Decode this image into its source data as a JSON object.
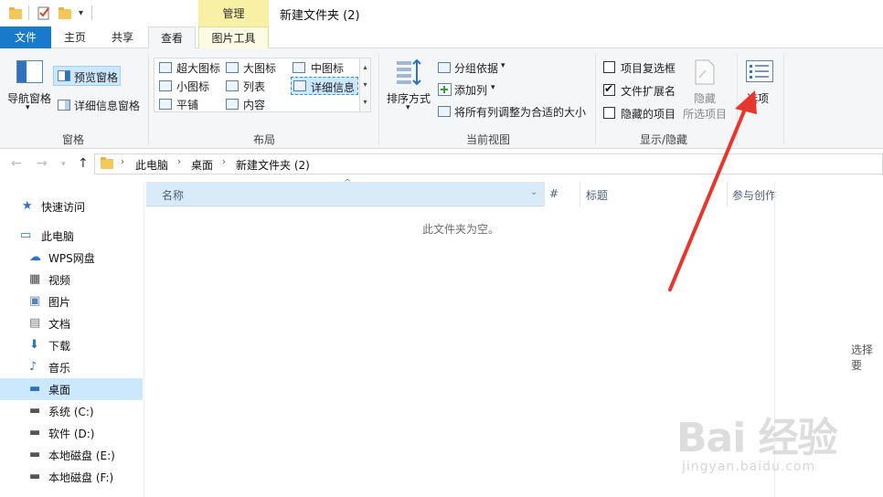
{
  "window": {
    "title": "新建文件夹 (2)",
    "context_tab": "管理"
  },
  "tabs": {
    "file": "文件",
    "home": "主页",
    "share": "共享",
    "view": "查看",
    "picture_tools": "图片工具"
  },
  "ribbon": {
    "panes": {
      "nav_pane": "导航窗格",
      "preview_pane": "预览窗格",
      "details_pane": "详细信息窗格",
      "label": "窗格"
    },
    "layout": {
      "extra_large": "超大图标",
      "large": "大图标",
      "medium": "中图标",
      "small": "小图标",
      "list": "列表",
      "details": "详细信息",
      "tiles": "平铺",
      "content": "内容",
      "label": "布局"
    },
    "current_view": {
      "sort_by": "排序方式",
      "group_by": "分组依据",
      "add_columns": "添加列",
      "size_columns": "将所有列调整为合适的大小",
      "label": "当前视图"
    },
    "show_hide": {
      "item_checkboxes": "项目复选框",
      "file_extensions": "文件扩展名",
      "hidden_items": "隐藏的项目",
      "hide_selected_1": "隐藏",
      "hide_selected_2": "所选项目",
      "options": "选项",
      "label": "显示/隐藏",
      "item_checkboxes_checked": false,
      "file_extensions_checked": true,
      "hidden_items_checked": false
    }
  },
  "address": {
    "crumbs": [
      "此电脑",
      "桌面",
      "新建文件夹 (2)"
    ]
  },
  "nav": {
    "items": [
      {
        "label": "快速访问",
        "icon": "star-icon"
      },
      {
        "label": "此电脑",
        "icon": "computer-icon"
      },
      {
        "label": "WPS网盘",
        "icon": "cloud-icon"
      },
      {
        "label": "视频",
        "icon": "video-icon"
      },
      {
        "label": "图片",
        "icon": "picture-icon"
      },
      {
        "label": "文档",
        "icon": "document-icon"
      },
      {
        "label": "下载",
        "icon": "download-icon"
      },
      {
        "label": "音乐",
        "icon": "music-icon"
      },
      {
        "label": "桌面",
        "icon": "desktop-icon"
      },
      {
        "label": "系统 (C:)",
        "icon": "drive-icon"
      },
      {
        "label": "软件 (D:)",
        "icon": "drive-icon"
      },
      {
        "label": "本地磁盘 (E:)",
        "icon": "drive-icon"
      },
      {
        "label": "本地磁盘 (F:)",
        "icon": "drive-icon"
      }
    ],
    "selected_index": 8
  },
  "content": {
    "columns": [
      "名称",
      "#",
      "标题",
      "参与创作"
    ],
    "empty_message": "此文件夹为空。",
    "side_hint": "选择要"
  },
  "watermark": {
    "brand": "Bai 经验",
    "url": "jingyan.baidu.com"
  },
  "colors": {
    "accent": "#1979ca",
    "context_tab": "#f8f1a5",
    "selected_nav": "#cce8ff",
    "annotation_arrow": "#e8362c"
  }
}
